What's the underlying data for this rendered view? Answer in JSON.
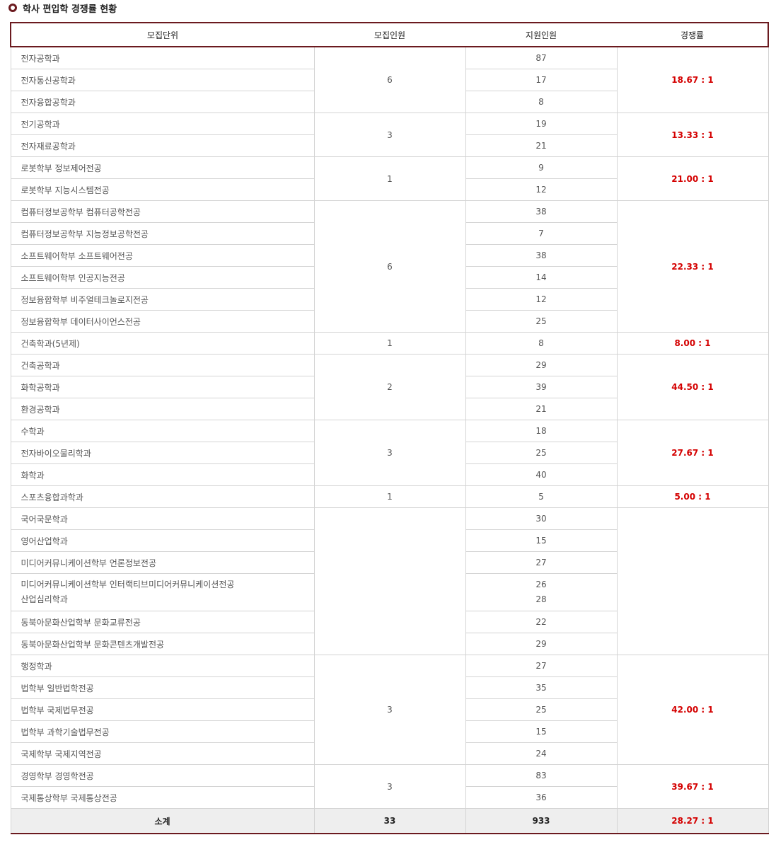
{
  "title": "학사 편입학 경쟁률 현황",
  "headers": [
    "모집단위",
    "모집인원",
    "지원인원",
    "경쟁률"
  ],
  "rows": [
    {
      "unit": "전자공학과",
      "applicants": "87"
    },
    {
      "unit": "전자통신공학과",
      "applicants": "17"
    },
    {
      "unit": "전자융합공학과",
      "applicants": "8"
    },
    {
      "unit": "전기공학과",
      "applicants": "19"
    },
    {
      "unit": "전자재료공학과",
      "applicants": "21"
    },
    {
      "unit": "로봇학부 정보제어전공",
      "applicants": "9"
    },
    {
      "unit": "로봇학부 지능시스템전공",
      "applicants": "12"
    },
    {
      "unit": "컴퓨터정보공학부 컴퓨터공학전공",
      "applicants": "38"
    },
    {
      "unit": "컴퓨터정보공학부 지능정보공학전공",
      "applicants": "7"
    },
    {
      "unit": "소프트웨어학부 소프트웨어전공",
      "applicants": "38"
    },
    {
      "unit": "소프트웨어학부 인공지능전공",
      "applicants": "14"
    },
    {
      "unit": "정보융합학부 비주얼테크놀로지전공",
      "applicants": "12"
    },
    {
      "unit": "정보융합학부 데이터사이언스전공",
      "applicants": "25"
    },
    {
      "unit": "건축학과(5년제)",
      "applicants": "8"
    },
    {
      "unit": "건축공학과",
      "applicants": "29"
    },
    {
      "unit": "화학공학과",
      "applicants": "39"
    },
    {
      "unit": "환경공학과",
      "applicants": "21"
    },
    {
      "unit": "수학과",
      "applicants": "18"
    },
    {
      "unit": "전자바이오물리학과",
      "applicants": "25"
    },
    {
      "unit": "화학과",
      "applicants": "40"
    },
    {
      "unit": "스포츠융합과학과",
      "applicants": "5"
    },
    {
      "unit": "국어국문학과",
      "applicants": "30"
    },
    {
      "unit": "영어산업학과",
      "applicants": "15"
    },
    {
      "unit": "미디어커뮤니케이션학부 언론정보전공",
      "applicants": "27"
    },
    {
      "unit": "미디어커뮤니케이션학부 인터랙티브미디어커뮤니케이션전공",
      "applicants": "26"
    },
    {
      "unit": "산업심리학과",
      "applicants": "28"
    },
    {
      "unit": "동북아문화산업학부 문화교류전공",
      "applicants": "22"
    },
    {
      "unit": "동북아문화산업학부 문화콘텐츠개발전공",
      "applicants": "29"
    },
    {
      "unit": "행정학과",
      "applicants": "27"
    },
    {
      "unit": "법학부 일반법학전공",
      "applicants": "35"
    },
    {
      "unit": "법학부 국제법무전공",
      "applicants": "25"
    },
    {
      "unit": "법학부 과학기술법무전공",
      "applicants": "15"
    },
    {
      "unit": "국제학부 국제지역전공",
      "applicants": "24"
    },
    {
      "unit": "경영학부 경영학전공",
      "applicants": "83"
    },
    {
      "unit": "국제통상학부 국제통상전공",
      "applicants": "36"
    }
  ],
  "groups": [
    {
      "quota": "6",
      "rate": "18.67 : 1"
    },
    {
      "quota": "3",
      "rate": "13.33 : 1"
    },
    {
      "quota": "1",
      "rate": "21.00 : 1"
    },
    {
      "quota": "6",
      "rate": "22.33 : 1"
    },
    {
      "quota": "1",
      "rate": "8.00 : 1"
    },
    {
      "quota": "2",
      "rate": "44.50 : 1"
    },
    {
      "quota": "3",
      "rate": "27.67 : 1"
    },
    {
      "quota": "1",
      "rate": "5.00 : 1"
    },
    {
      "quota": "",
      "rate": ""
    },
    {
      "quota": "3",
      "rate": ""
    },
    {
      "quota": "",
      "rate": "42.00 : 1"
    },
    {
      "quota": "3",
      "rate": "39.67 : 1"
    }
  ],
  "total": {
    "label": "소계",
    "quota": "33",
    "applicants": "933",
    "rate": "28.27 : 1"
  }
}
